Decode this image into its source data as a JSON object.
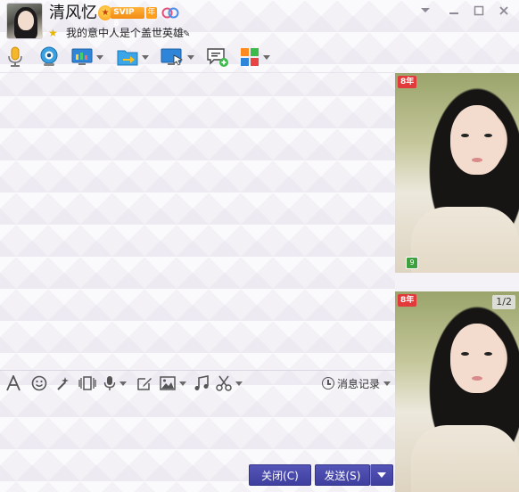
{
  "contact": {
    "name": "清风忆",
    "vip_label": "SVIP 8",
    "vip_year_label": "年",
    "signature": "我的意中人是个盖世英雄"
  },
  "window_controls": [
    "chevron-down-icon",
    "minimize-icon",
    "maximize-icon",
    "close-icon"
  ],
  "toolbar": {
    "items": [
      {
        "icon": "microphone-icon",
        "dropdown": false
      },
      {
        "icon": "webcam-icon",
        "dropdown": false
      },
      {
        "icon": "screen-share-icon",
        "dropdown": true
      },
      {
        "icon": "file-transfer-icon",
        "dropdown": true
      },
      {
        "icon": "remote-desktop-icon",
        "dropdown": true
      },
      {
        "icon": "create-discussion-icon",
        "dropdown": false
      },
      {
        "icon": "apps-icon",
        "dropdown": true
      }
    ]
  },
  "input_toolbar": {
    "items": [
      {
        "icon": "font-icon",
        "dropdown": false
      },
      {
        "icon": "emoji-icon",
        "dropdown": false
      },
      {
        "icon": "magic-wand-icon",
        "dropdown": false
      },
      {
        "icon": "shake-icon",
        "dropdown": false
      },
      {
        "icon": "voice-message-icon",
        "dropdown": true
      },
      {
        "icon": "edit-icon",
        "dropdown": false
      },
      {
        "icon": "image-icon",
        "dropdown": true
      },
      {
        "icon": "music-icon",
        "dropdown": false
      },
      {
        "icon": "screenshot-icon",
        "dropdown": true
      }
    ],
    "history_label": "消息记录"
  },
  "buttons": {
    "close_label": "关闭(C)",
    "send_label": "发送(S)"
  },
  "side_panel": {
    "badge_label": "8年",
    "level_label": "9",
    "page_indicator": "1/2"
  },
  "colors": {
    "button_bg": "#4848a8",
    "background": "#f3f1f6"
  }
}
